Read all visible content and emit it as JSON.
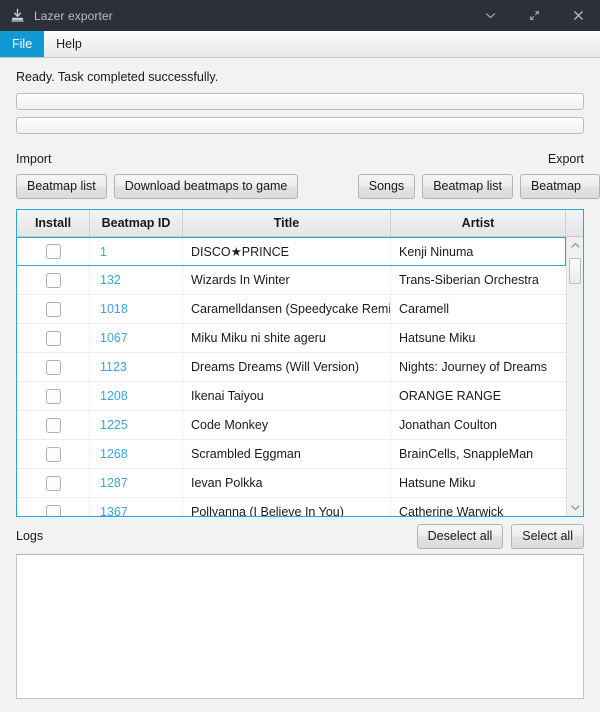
{
  "window": {
    "title": "Lazer exporter",
    "icon": "app-export-icon",
    "controls": [
      {
        "name": "minimize-button",
        "icon": "chevron-down-icon"
      },
      {
        "name": "maximize-button",
        "icon": "diagonal-arrows-icon"
      },
      {
        "name": "close-button",
        "icon": "close-icon"
      }
    ],
    "titlebar_bg": "#2b303b",
    "accent": "#1199d6"
  },
  "menubar": {
    "items": [
      {
        "label": "File",
        "active": true
      },
      {
        "label": "Help",
        "active": false
      }
    ]
  },
  "status": {
    "text": "Ready. Task completed successfully.",
    "progress_bars": [
      {
        "name": "progress-bar-primary",
        "value": 0
      },
      {
        "name": "progress-bar-secondary",
        "value": 0
      }
    ]
  },
  "io": {
    "import_label": "Import",
    "export_label": "Export",
    "import_buttons": [
      {
        "label": "Beatmap list",
        "name": "import-beatmap-list-button"
      },
      {
        "label": "Download beatmaps to game",
        "name": "download-beatmaps-to-game-button"
      }
    ],
    "export_buttons": [
      {
        "label": "Songs",
        "name": "export-songs-button"
      },
      {
        "label": "Beatmap list",
        "name": "export-beatmap-list-button"
      },
      {
        "label": "Beatmap",
        "name": "export-beatmap-button"
      }
    ]
  },
  "table": {
    "columns": [
      "Install",
      "Beatmap ID",
      "Title",
      "Artist"
    ],
    "rows": [
      {
        "checked": false,
        "id": "1",
        "title": "DISCO★PRINCE",
        "artist": "Kenji Ninuma",
        "selected": true
      },
      {
        "checked": false,
        "id": "132",
        "title": "Wizards In Winter",
        "artist": "Trans-Siberian Orchestra",
        "selected": false
      },
      {
        "checked": false,
        "id": "1018",
        "title": "Caramelldansen (Speedycake Remix)",
        "artist": "Caramell",
        "selected": false
      },
      {
        "checked": false,
        "id": "1067",
        "title": "Miku Miku ni shite ageru",
        "artist": "Hatsune Miku",
        "selected": false
      },
      {
        "checked": false,
        "id": "1123",
        "title": "Dreams Dreams (Will Version)",
        "artist": "Nights: Journey of Dreams",
        "selected": false
      },
      {
        "checked": false,
        "id": "1208",
        "title": "Ikenai Taiyou",
        "artist": "ORANGE RANGE",
        "selected": false
      },
      {
        "checked": false,
        "id": "1225",
        "title": "Code Monkey",
        "artist": "Jonathan Coulton",
        "selected": false
      },
      {
        "checked": false,
        "id": "1268",
        "title": "Scrambled Eggman",
        "artist": "BrainCells, SnappleMan",
        "selected": false
      },
      {
        "checked": false,
        "id": "1287",
        "title": "Ievan Polkka",
        "artist": "Hatsune Miku",
        "selected": false
      },
      {
        "checked": false,
        "id": "1367",
        "title": "Pollyanna (I Believe In You)",
        "artist": "Catherine Warwick",
        "selected": false
      }
    ],
    "id_color": "#3ba7d4",
    "border_color": "#29a8e0",
    "scrollbar": {
      "up_icon": "chevron-up-icon",
      "down_icon": "chevron-down-icon"
    }
  },
  "logs": {
    "label": "Logs",
    "content": "",
    "deselect_all_label": "Deselect all",
    "select_all_label": "Select all"
  }
}
